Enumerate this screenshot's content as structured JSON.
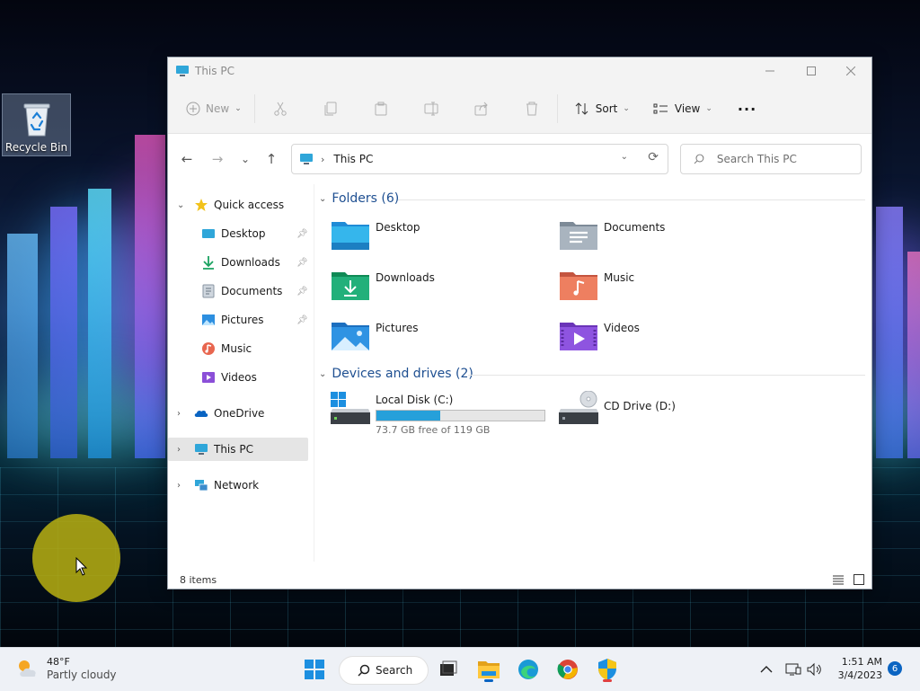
{
  "desktop": {
    "recycle_bin_label": "Recycle Bin"
  },
  "window": {
    "title": "This PC",
    "controls": {
      "minimize": "—",
      "maximize": "☐",
      "close": "✕"
    }
  },
  "toolbar": {
    "new_label": "New",
    "sort_label": "Sort",
    "view_label": "View",
    "more_label": "···"
  },
  "navigation": {
    "back": "←",
    "forward": "→",
    "recent": "⌄",
    "up": "↑",
    "address_sep": "›",
    "address_path": "This PC",
    "search_placeholder": "Search This PC"
  },
  "sidebar": {
    "quick_access": "Quick access",
    "pinned": [
      {
        "label": "Desktop",
        "icon": "desktop-icon",
        "pinned": true
      },
      {
        "label": "Downloads",
        "icon": "downloads-icon",
        "pinned": true
      },
      {
        "label": "Documents",
        "icon": "documents-icon",
        "pinned": true
      },
      {
        "label": "Pictures",
        "icon": "pictures-icon",
        "pinned": true
      },
      {
        "label": "Music",
        "icon": "music-icon",
        "pinned": false
      },
      {
        "label": "Videos",
        "icon": "videos-icon",
        "pinned": false
      }
    ],
    "onedrive": "OneDrive",
    "this_pc": "This PC",
    "network": "Network"
  },
  "content": {
    "folders_header": "Folders (6)",
    "folders": [
      {
        "name": "Desktop",
        "icon": "desktop-folder-icon"
      },
      {
        "name": "Documents",
        "icon": "documents-folder-icon"
      },
      {
        "name": "Downloads",
        "icon": "downloads-folder-icon"
      },
      {
        "name": "Music",
        "icon": "music-folder-icon"
      },
      {
        "name": "Pictures",
        "icon": "pictures-folder-icon"
      },
      {
        "name": "Videos",
        "icon": "videos-folder-icon"
      }
    ],
    "drives_header": "Devices and drives (2)",
    "drives": [
      {
        "name": "Local Disk (C:)",
        "free_text": "73.7 GB free of 119 GB",
        "used_fraction": 0.38
      },
      {
        "name": "CD Drive (D:)"
      }
    ]
  },
  "status": {
    "item_count": "8 items"
  },
  "taskbar": {
    "weather_temp": "48°F",
    "weather_condition": "Partly cloudy",
    "search_label": "Search",
    "clock_time": "1:51 AM",
    "clock_date": "3/4/2023",
    "notification_count": "6"
  },
  "colors": {
    "accent": "#0a64c2",
    "drive_fill": "#26a0da",
    "section_header": "#1e4f91",
    "cursor_highlight": "#b8b012"
  }
}
